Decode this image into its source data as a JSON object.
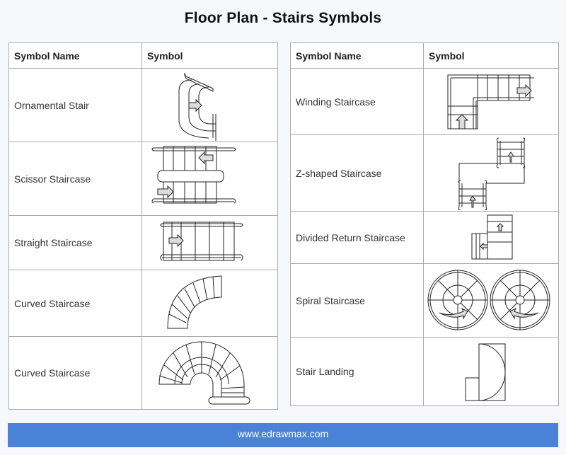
{
  "title": "Floor Plan - Stairs Symbols",
  "tables": [
    {
      "headers": [
        "Symbol Name",
        "Symbol"
      ],
      "rows": [
        {
          "name": "Ornamental Stair",
          "icon": "ornamental-stair-symbol"
        },
        {
          "name": "Scissor Staircase",
          "icon": "scissor-staircase-symbol"
        },
        {
          "name": "Straight Staircase",
          "icon": "straight-staircase-symbol"
        },
        {
          "name": "Curved Staircase",
          "icon": "curved-staircase-symbol"
        },
        {
          "name": "Curved Staircase",
          "icon": "curved-staircase-landing-symbol"
        }
      ]
    },
    {
      "headers": [
        "Symbol Name",
        "Symbol"
      ],
      "rows": [
        {
          "name": "Winding Staircase",
          "icon": "winding-staircase-symbol"
        },
        {
          "name": "Z-shaped Staircase",
          "icon": "z-shaped-staircase-symbol"
        },
        {
          "name": "Divided Return Staircase",
          "icon": "divided-return-staircase-symbol"
        },
        {
          "name": "Spiral Staircase",
          "icon": "spiral-staircase-symbol"
        },
        {
          "name": "Stair Landing",
          "icon": "stair-landing-symbol"
        }
      ]
    }
  ],
  "footer": "www.edrawmax.com"
}
